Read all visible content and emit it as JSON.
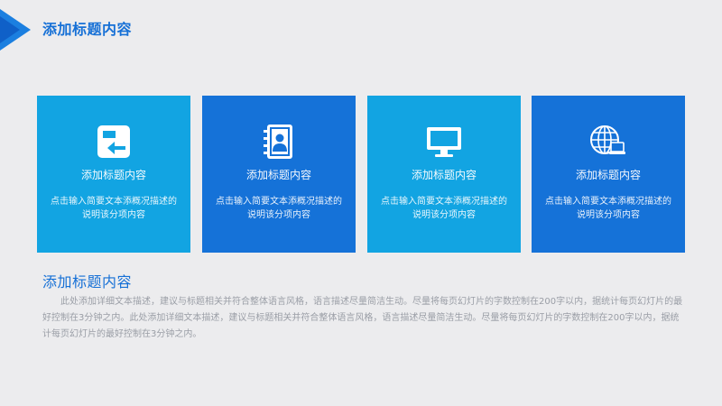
{
  "header": {
    "title": "添加标题内容"
  },
  "cards": [
    {
      "title": "添加标题内容",
      "description": "点击输入简要文本添概况描述的说明该分项内容",
      "icon": "exit-door-icon",
      "color": "#12a4e2"
    },
    {
      "title": "添加标题内容",
      "description": "点击输入简要文本添概况描述的说明该分项内容",
      "icon": "contact-book-icon",
      "color": "#1572d8"
    },
    {
      "title": "添加标题内容",
      "description": "点击输入简要文本添概况描述的说明该分项内容",
      "icon": "monitor-icon",
      "color": "#12a4e2"
    },
    {
      "title": "添加标题内容",
      "description": "点击输入简要文本添概况描述的说明该分项内容",
      "icon": "globe-laptop-icon",
      "color": "#1572d8"
    }
  ],
  "section": {
    "title": "添加标题内容",
    "body": "此处添加详细文本描述，建议与标题相关并符合整体语言风格，语言描述尽量简洁生动。尽量将每页幻灯片的字数控制在200字以内，据统计每页幻灯片的最好控制在3分钟之内。此处添加详细文本描述，建议与标题相关并符合整体语言风格，语言描述尽量简洁生动。尽量将每页幻灯片的字数控制在200字以内，据统计每页幻灯片的最好控制在3分钟之内。"
  },
  "colors": {
    "accent": "#1670d6",
    "card_light": "#12a4e2",
    "card_dark": "#1572d8",
    "background": "#ececee"
  }
}
